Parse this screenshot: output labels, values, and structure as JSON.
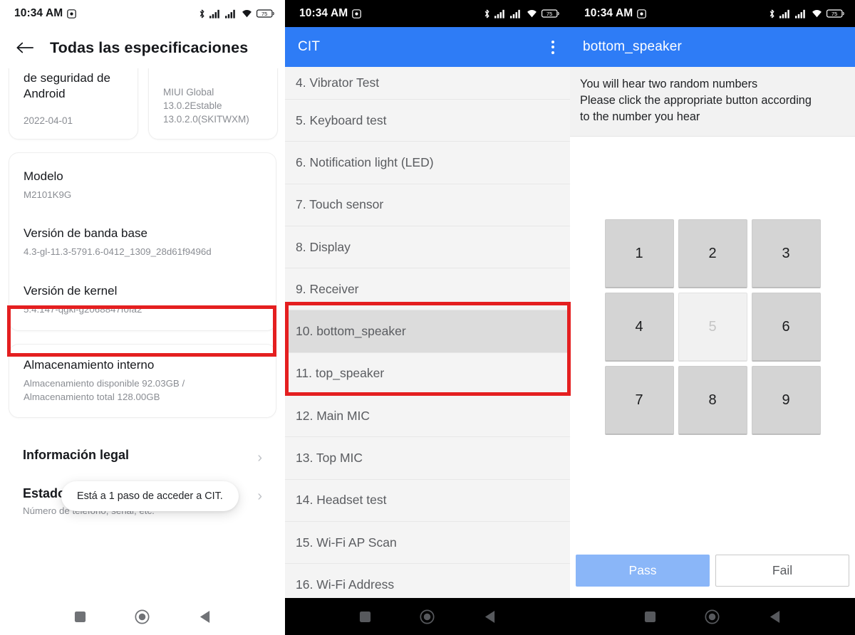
{
  "status_bar": {
    "time": "10:34 AM",
    "icons": [
      "screen-record-icon",
      "bluetooth-icon",
      "signal-1-icon",
      "signal-2-icon",
      "wifi-icon",
      "battery-icon"
    ],
    "battery_level": "75"
  },
  "left_panel": {
    "appbar": {
      "back_icon": "back-arrow-icon",
      "title": "Todas las especificaciones"
    },
    "top_cards": [
      {
        "title": "de seguridad de Android",
        "value": "2022-04-01"
      },
      {
        "title": "",
        "value": "MIUI Global 13.0.2Estable 13.0.2.0(SKITWXM)",
        "value_lines": [
          "MIUI Global",
          "13.0.2Estable",
          "13.0.2.0(SKITWXM)"
        ]
      }
    ],
    "specs": [
      {
        "label": "Modelo",
        "value": "M2101K9G"
      },
      {
        "label": "Versión de banda base",
        "value": "4.3-gl-11.3-5791.6-0412_1309_28d61f9496d"
      },
      {
        "label": "Versión de kernel",
        "value": "5.4.147-qgki-g2068847f0fa2",
        "highlighted": true
      }
    ],
    "storage": {
      "label": "Almacenamiento interno",
      "value_line1": "Almacenamiento disponible  92.03GB /",
      "value_line2": "Almacenamiento total  128.00GB"
    },
    "links": [
      {
        "title": "Información legal",
        "sub": "",
        "chevron": "chevron-right-icon"
      },
      {
        "title": "Estado",
        "sub": "Número de teléfono, señal, etc.",
        "chevron": "chevron-right-icon"
      }
    ],
    "toast": "Está a 1 paso de acceder a CIT.",
    "navbar": [
      "recents-square-icon",
      "home-circle-icon",
      "back-triangle-icon"
    ]
  },
  "mid_panel": {
    "appbar": {
      "title": "CIT",
      "overflow_icon": "more-vertical-icon"
    },
    "items": [
      {
        "label": "4. Vibrator Test",
        "selected": false
      },
      {
        "label": "5. Keyboard test",
        "selected": false
      },
      {
        "label": "6. Notification light (LED)",
        "selected": false
      },
      {
        "label": "7. Touch sensor",
        "selected": false
      },
      {
        "label": "8. Display",
        "selected": false
      },
      {
        "label": "9. Receiver",
        "selected": false
      },
      {
        "label": "10. bottom_speaker",
        "selected": true
      },
      {
        "label": "11. top_speaker",
        "selected": false
      },
      {
        "label": "12. Main MIC",
        "selected": false
      },
      {
        "label": "13. Top MIC",
        "selected": false
      },
      {
        "label": "14. Headset test",
        "selected": false
      },
      {
        "label": "15. Wi-Fi AP Scan",
        "selected": false
      },
      {
        "label": "16. Wi-Fi Address",
        "selected": false
      }
    ],
    "navbar": [
      "recents-square-icon",
      "home-circle-icon",
      "back-triangle-icon"
    ]
  },
  "right_panel": {
    "appbar": {
      "title": "bottom_speaker"
    },
    "instructions_line1": "You will hear two random numbers",
    "instructions_line2": "Please click the appropriate button according",
    "instructions_line3": "to the number you hear",
    "keys": [
      {
        "label": "1",
        "dim": false
      },
      {
        "label": "2",
        "dim": false
      },
      {
        "label": "3",
        "dim": false
      },
      {
        "label": "4",
        "dim": false
      },
      {
        "label": "5",
        "dim": true
      },
      {
        "label": "6",
        "dim": false
      },
      {
        "label": "7",
        "dim": false
      },
      {
        "label": "8",
        "dim": false
      },
      {
        "label": "9",
        "dim": false
      }
    ],
    "pass_label": "Pass",
    "fail_label": "Fail",
    "navbar": [
      "recents-square-icon",
      "home-circle-icon",
      "back-triangle-icon"
    ]
  },
  "annotations": {
    "highlight_color": "#e41f20",
    "boxes": [
      "kernel-version-row",
      "speaker-test-rows"
    ]
  },
  "colors": {
    "appbar_blue": "#2e7cf6",
    "pass_blue": "#8ab6f8",
    "list_bg": "#f4f4f4",
    "list_selected": "#dcdcdc",
    "key_gray": "#d4d4d4"
  }
}
